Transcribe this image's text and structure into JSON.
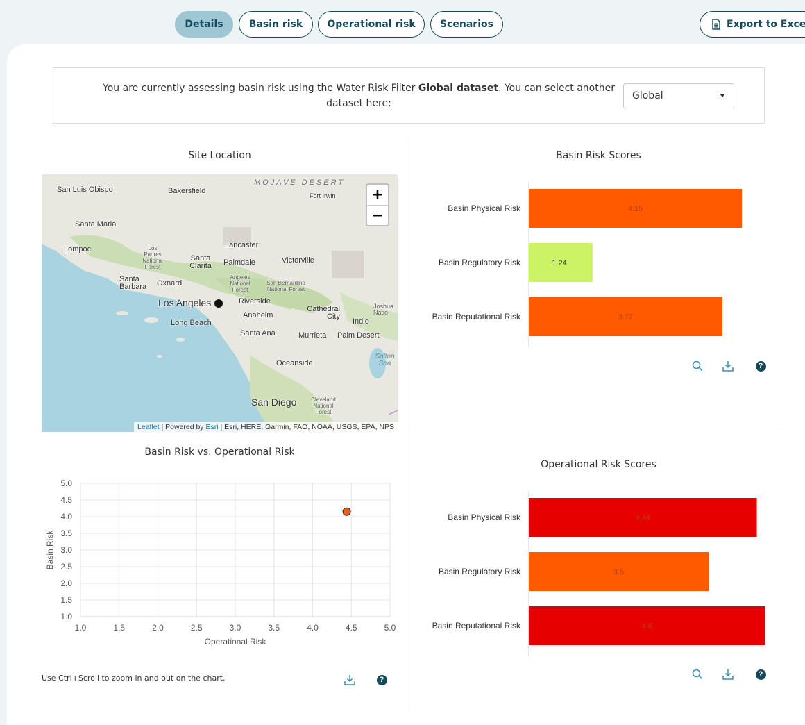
{
  "tabs": [
    {
      "label": "Details",
      "active": true
    },
    {
      "label": "Basin risk",
      "active": false
    },
    {
      "label": "Operational risk",
      "active": false
    },
    {
      "label": "Scenarios",
      "active": false
    }
  ],
  "export_label": "Export to Excel",
  "notice": {
    "text_before": "You are currently assessing basin risk using the Water Risk Filter ",
    "text_bold": "Global dataset",
    "text_after": ". You can select another dataset here:",
    "dataset_value": "Global"
  },
  "site_location": {
    "title": "Site Location",
    "zoom_in": "+",
    "zoom_out": "−",
    "attribution": {
      "leaflet": "Leaflet",
      "powered_by": " | Powered by ",
      "esri": "Esri",
      "sources": " | Esri, HERE, Garmin, FAO, NOAA, USGS, EPA, NPS"
    },
    "labels": [
      "San Luis Obispo",
      "Bakersfield",
      "MOJAVE DESERT",
      "Fort Irwin",
      "Santa Maria",
      "Lompoc",
      "Los Padres National Forest",
      "Lancaster",
      "Santa Clarita",
      "Palmdale",
      "Victorville",
      "Santa Barbara",
      "Oxnard",
      "Angeles National Forest",
      "San Bernardino National Forest",
      "Los Angeles",
      "Riverside",
      "Cathedral City",
      "Joshua Natio",
      "Long Beach",
      "Anaheim",
      "Indio",
      "Santa Ana",
      "Murrieta",
      "Palm Desert",
      "Salton Sea",
      "Oceanside",
      "San Diego",
      "Cleveland National Forest"
    ]
  },
  "basin_scores": {
    "title": "Basin Risk Scores",
    "chart_data": {
      "type": "bar",
      "orientation": "horizontal",
      "categories": [
        "Basin Physical Risk",
        "Basin Regulatory Risk",
        "Basin Reputational Risk"
      ],
      "values": [
        4.15,
        1.24,
        3.77
      ],
      "labels": [
        "4.15",
        "1.24",
        "3.77"
      ],
      "colors": [
        "#ff5a00",
        "#ccf266",
        "#ff5a00"
      ],
      "xlim": [
        0,
        5
      ]
    }
  },
  "scatter": {
    "title": "Basin Risk vs. Operational Risk",
    "hint": "Use Ctrl+Scroll to zoom in and out on the chart.",
    "chart_data": {
      "type": "scatter",
      "xlabel": "Operational Risk",
      "ylabel": "Basin Risk",
      "xlim": [
        1.0,
        5.0
      ],
      "ylim": [
        1.0,
        5.0
      ],
      "xticks": [
        "1.0",
        "1.5",
        "2.0",
        "2.5",
        "3.0",
        "3.5",
        "4.0",
        "4.5",
        "5.0"
      ],
      "yticks": [
        "1.0",
        "1.5",
        "2.0",
        "2.5",
        "3.0",
        "3.5",
        "4.0",
        "4.5",
        "5.0"
      ],
      "grid": true,
      "points": [
        {
          "x": 4.44,
          "y": 4.15,
          "color": "#f05a1e"
        }
      ]
    }
  },
  "operational_scores": {
    "title": "Operational Risk Scores",
    "chart_data": {
      "type": "bar",
      "orientation": "horizontal",
      "categories": [
        "Basin Physical Risk",
        "Basin Regulatory Risk",
        "Basin Reputational Risk"
      ],
      "values": [
        4.44,
        3.5,
        4.6
      ],
      "labels": [
        "4.44",
        "3.5",
        "4.6"
      ],
      "colors": [
        "#e60000",
        "#ff5a00",
        "#e60000"
      ],
      "xlim": [
        0,
        5
      ]
    }
  },
  "icons": {
    "zoom": "magnifier-icon",
    "download": "download-icon",
    "help": "help-icon",
    "export": "excel-file-icon"
  }
}
